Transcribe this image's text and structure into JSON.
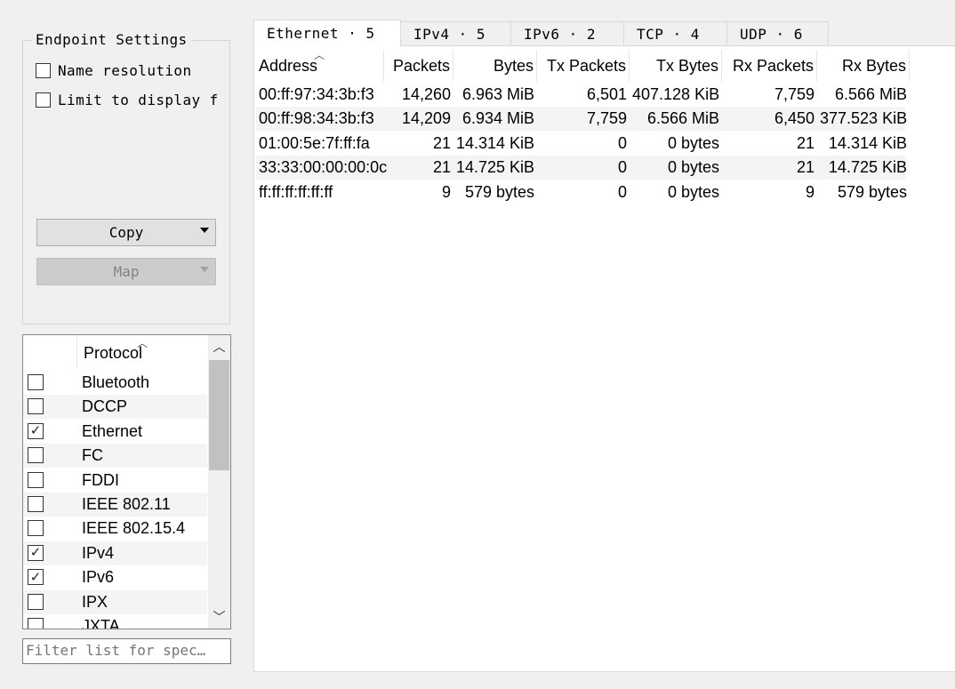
{
  "settings": {
    "legend": "Endpoint Settings",
    "name_resolution": {
      "label": "Name resolution",
      "checked": false
    },
    "limit_display": {
      "label": "Limit to display f",
      "checked": false
    },
    "copy_label": "Copy",
    "map_label": "Map"
  },
  "protocols": {
    "header": "Protocol",
    "items": [
      {
        "name": "Bluetooth",
        "checked": false
      },
      {
        "name": "DCCP",
        "checked": false
      },
      {
        "name": "Ethernet",
        "checked": true
      },
      {
        "name": "FC",
        "checked": false
      },
      {
        "name": "FDDI",
        "checked": false
      },
      {
        "name": "IEEE 802.11",
        "checked": false
      },
      {
        "name": "IEEE 802.15.4",
        "checked": false
      },
      {
        "name": "IPv4",
        "checked": true
      },
      {
        "name": "IPv6",
        "checked": true
      },
      {
        "name": "IPX",
        "checked": false
      },
      {
        "name": "JXTA",
        "checked": false
      }
    ]
  },
  "filter": {
    "placeholder": "Filter list for spec…"
  },
  "tabs": [
    {
      "label": "Ethernet · 5",
      "active": true
    },
    {
      "label": "IPv4 · 5",
      "active": false
    },
    {
      "label": "IPv6 · 2",
      "active": false
    },
    {
      "label": "TCP · 4",
      "active": false
    },
    {
      "label": "UDP · 6",
      "active": false
    }
  ],
  "table": {
    "columns": [
      "Address",
      "Packets",
      "Bytes",
      "Tx Packets",
      "Tx Bytes",
      "Rx Packets",
      "Rx Bytes"
    ],
    "rows": [
      [
        "00:ff:97:34:3b:f3",
        "14,260",
        "6.963 MiB",
        "6,501",
        "407.128 KiB",
        "7,759",
        "6.566 MiB"
      ],
      [
        "00:ff:98:34:3b:f3",
        "14,209",
        "6.934 MiB",
        "7,759",
        "6.566 MiB",
        "6,450",
        "377.523 KiB"
      ],
      [
        "01:00:5e:7f:ff:fa",
        "21",
        "14.314 KiB",
        "0",
        "0 bytes",
        "21",
        "14.314 KiB"
      ],
      [
        "33:33:00:00:00:0c",
        "21",
        "14.725 KiB",
        "0",
        "0 bytes",
        "21",
        "14.725 KiB"
      ],
      [
        "ff:ff:ff:ff:ff:ff",
        "9",
        "579 bytes",
        "0",
        "0 bytes",
        "9",
        "579 bytes"
      ]
    ]
  }
}
